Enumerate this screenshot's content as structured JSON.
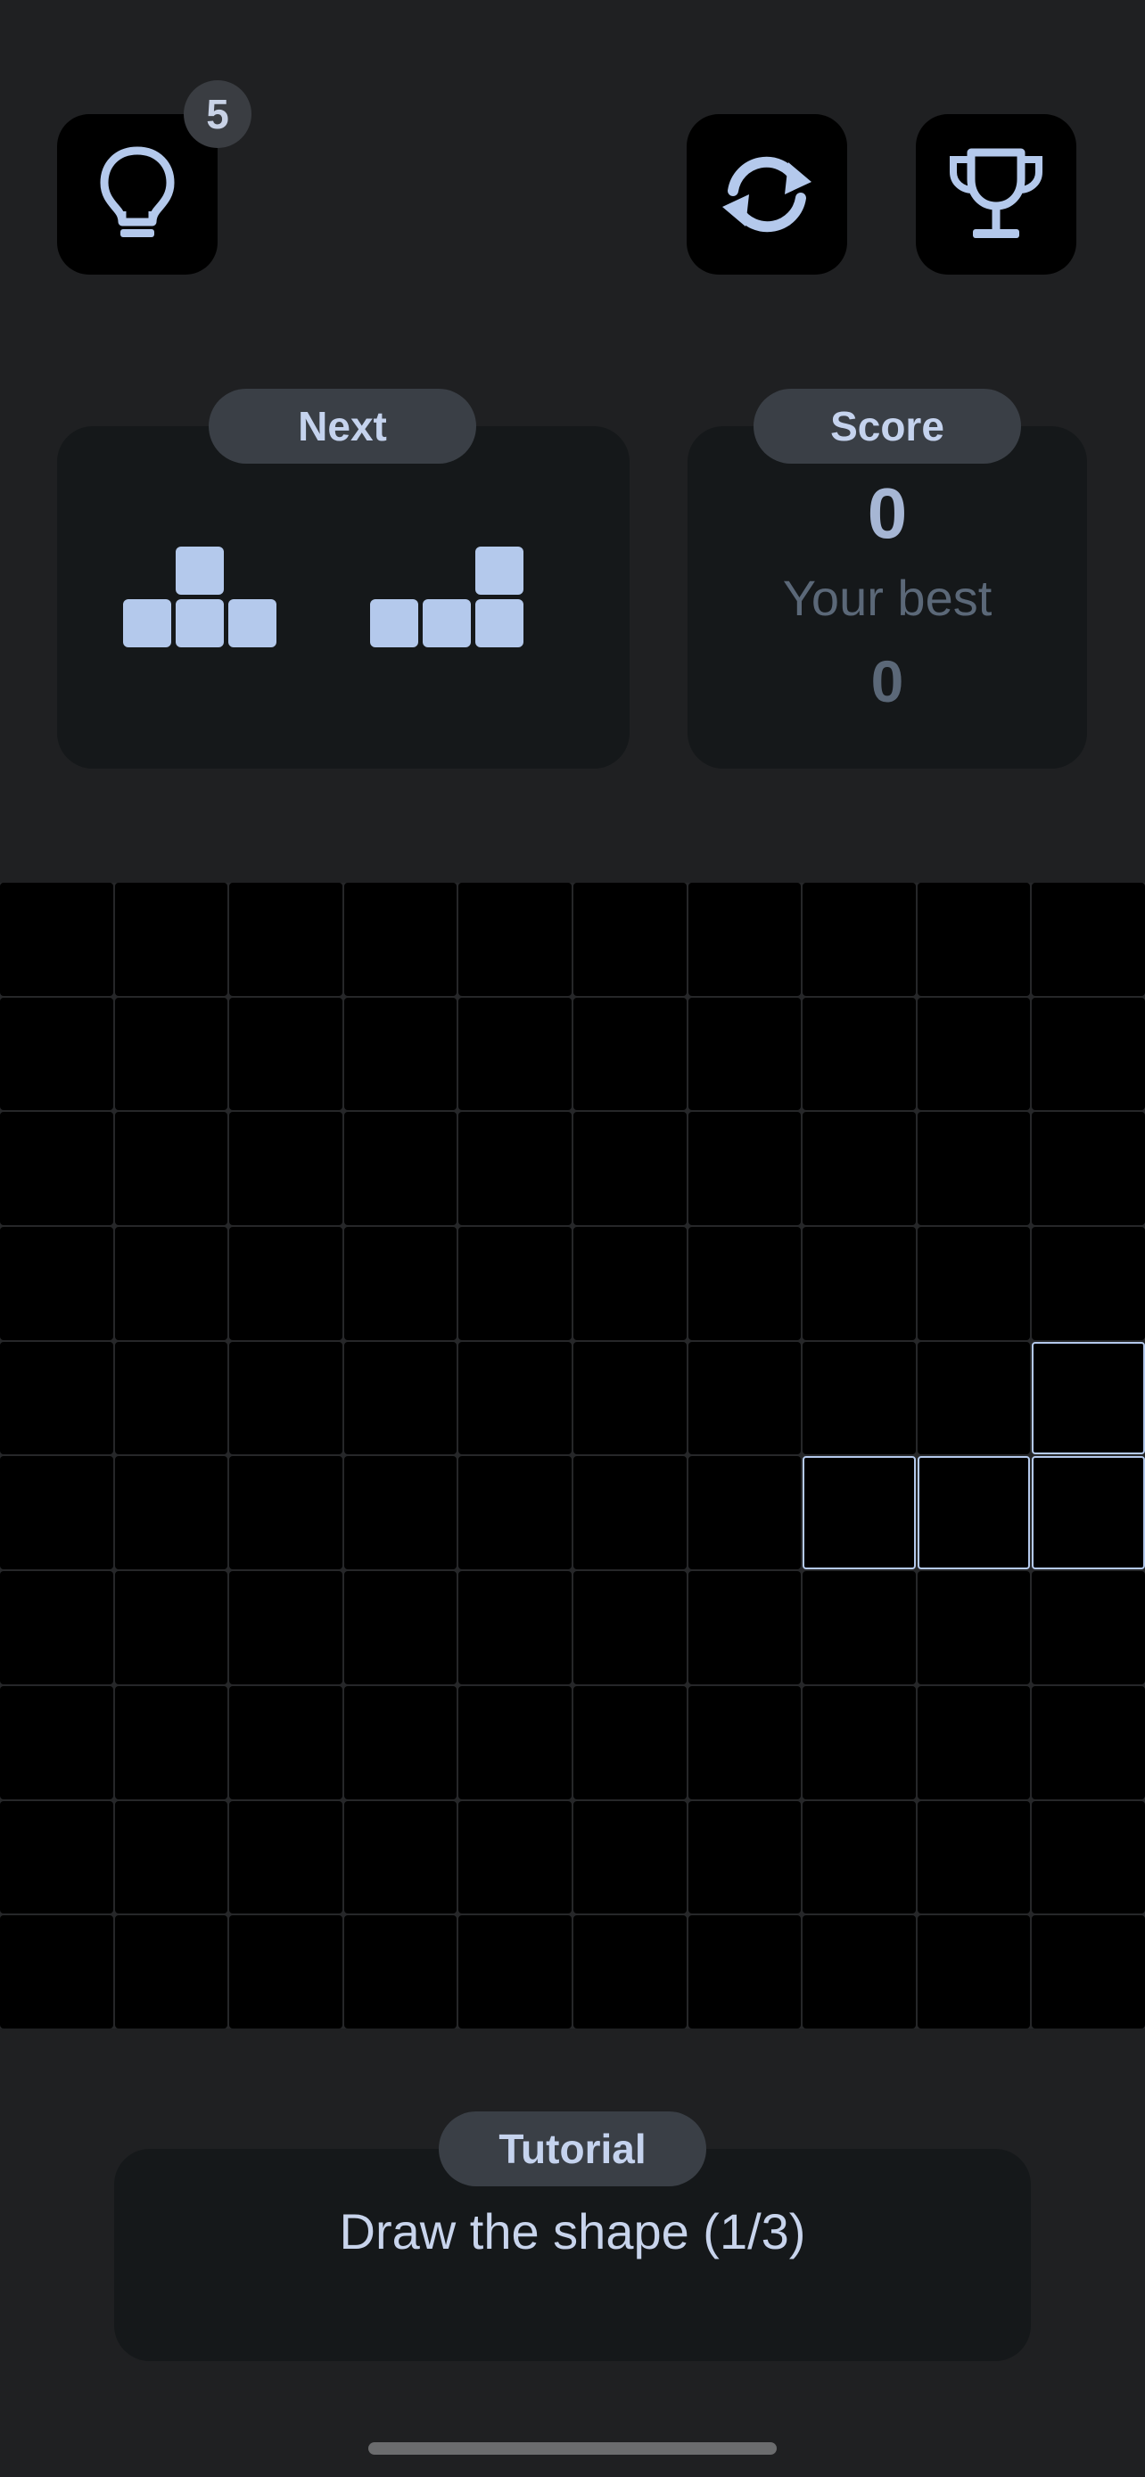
{
  "toolbar": {
    "hint_badge": "5",
    "hint_icon": "lightbulb-icon",
    "restart_icon": "refresh-icon",
    "leaderboard_icon": "trophy-icon"
  },
  "next": {
    "label": "Next",
    "pieces": [
      [
        [
          0,
          1,
          0
        ],
        [
          1,
          1,
          1
        ]
      ],
      [
        [
          0,
          0,
          1
        ],
        [
          1,
          1,
          1
        ]
      ]
    ]
  },
  "score": {
    "label": "Score",
    "value": "0",
    "best_label": "Your best",
    "best_value": "0"
  },
  "board": {
    "rows": 10,
    "cols": 10,
    "highlighted": [
      [
        4,
        9
      ],
      [
        5,
        7
      ],
      [
        5,
        8
      ],
      [
        5,
        9
      ]
    ]
  },
  "tutorial": {
    "label": "Tutorial",
    "text": "Draw the shape (1/3)"
  },
  "colors": {
    "background": "#1f2022",
    "accent": "#b4c9ec",
    "cell": "#000000"
  }
}
